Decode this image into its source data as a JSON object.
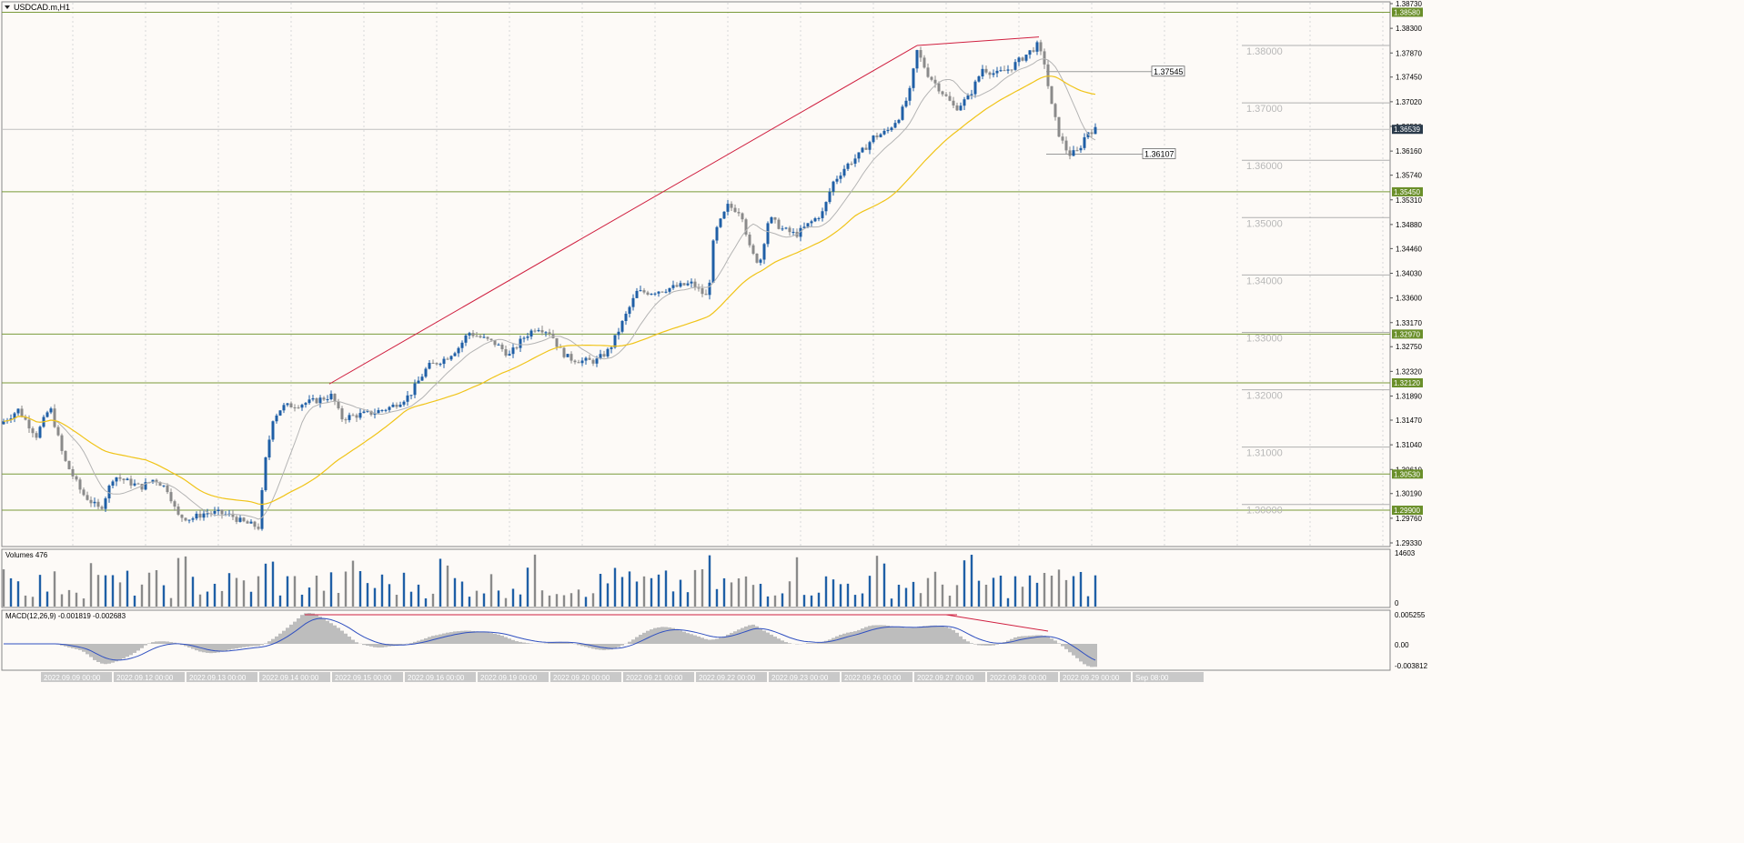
{
  "window": {
    "title": "USDCAD.m,H1"
  },
  "volume_panel": {
    "label": "Volumes 476",
    "max_label": "14603",
    "zero_label": "0"
  },
  "macd_panel": {
    "label": "MACD(12,26,9) -0.001819 -0.002683",
    "top_label": "0.005255",
    "zero_label": "0.00",
    "bottom_label": "-0.003812"
  },
  "colors": {
    "background": "#fdfaf7",
    "bull_candle": "#1f5fa6",
    "bear_candle": "#8a8a8a",
    "ma_fast": "#b4b4b4",
    "ma_slow": "#f0c419",
    "level_line": "#7a9a3a",
    "trend_line": "#d02040",
    "current_price_box": "#2a3a4a",
    "macd_signal": "#3050c0",
    "macd_hist": "#bdbdbd"
  },
  "chart_data": {
    "type": "candlestick",
    "symbol": "USDCAD.m",
    "timeframe": "H1",
    "y_axis": {
      "min": 1.2933,
      "max": 1.3873,
      "tick_labels": [
        "1.38730",
        "1.38300",
        "1.37870",
        "1.37450",
        "1.37020",
        "1.36590",
        "1.36160",
        "1.35740",
        "1.35310",
        "1.34880",
        "1.34460",
        "1.34030",
        "1.33600",
        "1.33170",
        "1.32750",
        "1.32320",
        "1.31890",
        "1.31470",
        "1.31040",
        "1.30610",
        "1.30190",
        "1.29760",
        "1.29330"
      ]
    },
    "x_axis": {
      "tick_labels": [
        "2022.09.09 00:00",
        "2022.09.12 00:00",
        "2022.09.13 00:00",
        "2022.09.14 00:00",
        "2022.09.15 00:00",
        "2022.09.16 00:00",
        "2022.09.19 00:00",
        "2022.09.20 00:00",
        "2022.09.21 00:00",
        "2022.09.22 00:00",
        "2022.09.23 00:00",
        "2022.09.26 00:00",
        "2022.09.27 00:00",
        "2022.09.28 00:00",
        "2022.09.29 00:00",
        "Sep 08:00"
      ]
    },
    "current_price": "1.36539",
    "horizontal_levels": [
      "1.38580",
      "1.35450",
      "1.32970",
      "1.32120",
      "1.30530",
      "1.29900"
    ],
    "price_markers": [
      "1.37545",
      "1.36107"
    ],
    "round_levels": [
      "1.38000",
      "1.37000",
      "1.36000",
      "1.35000",
      "1.34000",
      "1.33000",
      "1.32000",
      "1.31000",
      "1.30000"
    ],
    "close_path": [
      [
        0,
        1.314
      ],
      [
        20,
        1.3165
      ],
      [
        40,
        1.312
      ],
      [
        55,
        1.317
      ],
      [
        70,
        1.308
      ],
      [
        90,
        1.302
      ],
      [
        110,
        1.299
      ],
      [
        125,
        1.305
      ],
      [
        140,
        1.304
      ],
      [
        155,
        1.303
      ],
      [
        170,
        1.3045
      ],
      [
        185,
        1.3025
      ],
      [
        195,
        1.298
      ],
      [
        210,
        1.2975
      ],
      [
        225,
        1.2985
      ],
      [
        240,
        1.2985
      ],
      [
        255,
        1.298
      ],
      [
        265,
        1.297
      ],
      [
        285,
        1.296
      ],
      [
        290,
        1.306
      ],
      [
        300,
        1.315
      ],
      [
        310,
        1.317
      ],
      [
        330,
        1.3175
      ],
      [
        345,
        1.318
      ],
      [
        365,
        1.319
      ],
      [
        375,
        1.315
      ],
      [
        390,
        1.3155
      ],
      [
        410,
        1.316
      ],
      [
        430,
        1.317
      ],
      [
        450,
        1.319
      ],
      [
        470,
        1.324
      ],
      [
        490,
        1.3255
      ],
      [
        505,
        1.3275
      ],
      [
        515,
        1.33
      ],
      [
        530,
        1.329
      ],
      [
        545,
        1.328
      ],
      [
        560,
        1.326
      ],
      [
        575,
        1.329
      ],
      [
        590,
        1.331
      ],
      [
        605,
        1.33
      ],
      [
        615,
        1.327
      ],
      [
        625,
        1.3255
      ],
      [
        640,
        1.325
      ],
      [
        655,
        1.325
      ],
      [
        670,
        1.327
      ],
      [
        685,
        1.332
      ],
      [
        700,
        1.337
      ],
      [
        715,
        1.337
      ],
      [
        730,
        1.3375
      ],
      [
        745,
        1.338
      ],
      [
        760,
        1.3385
      ],
      [
        778,
        1.336
      ],
      [
        785,
        1.347
      ],
      [
        800,
        1.352
      ],
      [
        815,
        1.351
      ],
      [
        825,
        1.344
      ],
      [
        835,
        1.342
      ],
      [
        845,
        1.35
      ],
      [
        860,
        1.348
      ],
      [
        875,
        1.347
      ],
      [
        890,
        1.349
      ],
      [
        905,
        1.351
      ],
      [
        915,
        1.356
      ],
      [
        930,
        1.359
      ],
      [
        945,
        1.361
      ],
      [
        960,
        1.364
      ],
      [
        975,
        1.365
      ],
      [
        990,
        1.368
      ],
      [
        1000,
        1.372
      ],
      [
        1008,
        1.379
      ],
      [
        1020,
        1.375
      ],
      [
        1035,
        1.372
      ],
      [
        1050,
        1.369
      ],
      [
        1065,
        1.371
      ],
      [
        1080,
        1.376
      ],
      [
        1095,
        1.375
      ],
      [
        1110,
        1.376
      ],
      [
        1125,
        1.378
      ],
      [
        1140,
        1.38
      ],
      [
        1148,
        1.377
      ],
      [
        1155,
        1.37
      ],
      [
        1165,
        1.364
      ],
      [
        1175,
        1.361
      ],
      [
        1185,
        1.3615
      ],
      [
        1195,
        1.365
      ],
      [
        1207,
        1.3654
      ]
    ],
    "trend_lines": [
      {
        "from": [
          362,
          1.321
        ],
        "to": [
          1008,
          1.38
        ]
      },
      {
        "from": [
          1008,
          1.38
        ],
        "to": [
          1142,
          1.3815
        ]
      }
    ]
  }
}
